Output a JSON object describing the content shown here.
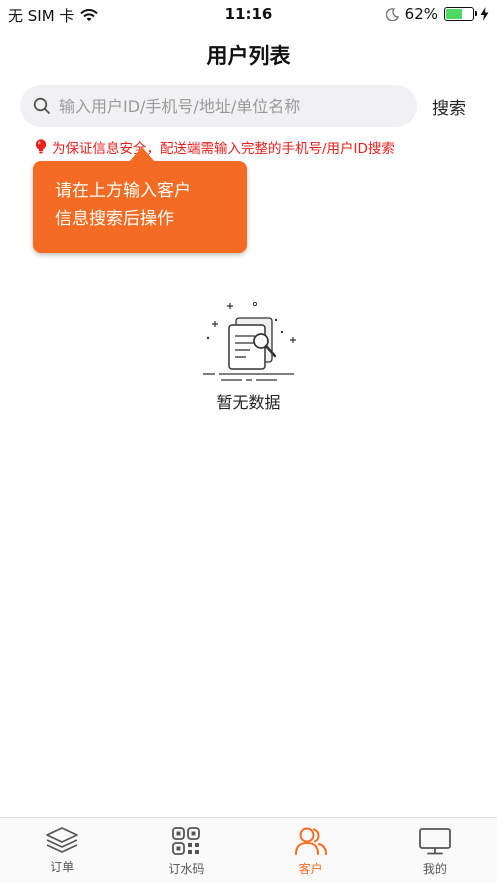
{
  "status_bar": {
    "carrier": "无 SIM 卡",
    "time": "11:16",
    "battery_percent": "62%",
    "battery_level": 0.62
  },
  "nav": {
    "title": "用户列表"
  },
  "search": {
    "placeholder": "输入用户ID/手机号/地址/单位名称",
    "value": "",
    "button_label": "搜索"
  },
  "tip": {
    "text": "为保证信息安全，配送端需输入完整的手机号/用户ID搜索"
  },
  "tooltip": {
    "line1": "请在上方输入客户",
    "line2": "信息搜索后操作"
  },
  "empty_state": {
    "text": "暂无数据"
  },
  "tab_bar": {
    "active_index": 2,
    "active_color": "#f46c23",
    "items": [
      {
        "label": "订单",
        "icon": "layers-icon"
      },
      {
        "label": "订水码",
        "icon": "qr-code-icon"
      },
      {
        "label": "客户",
        "icon": "users-icon"
      },
      {
        "label": "我的",
        "icon": "monitor-icon"
      }
    ]
  },
  "colors": {
    "accent": "#f46c23",
    "tip_red": "#e8211d",
    "search_bg": "#f1f1f3"
  }
}
